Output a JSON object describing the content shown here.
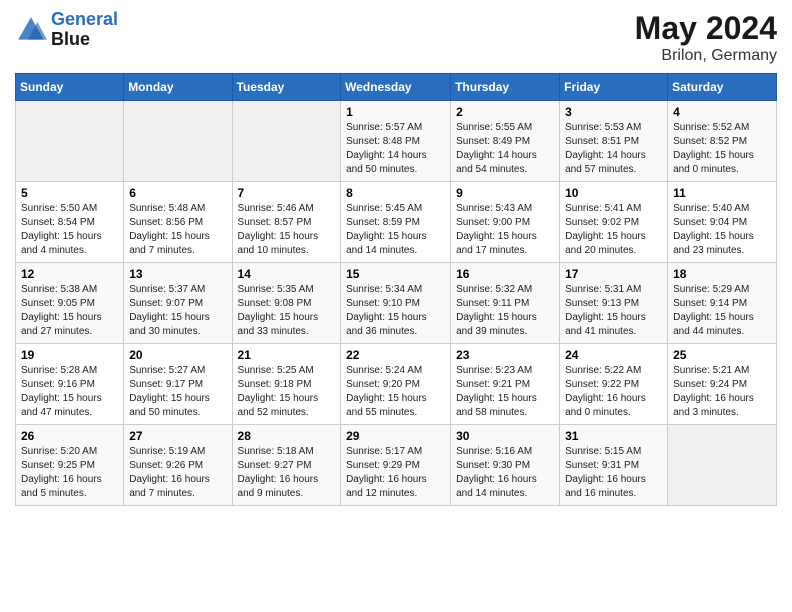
{
  "header": {
    "logo_line1": "General",
    "logo_line2": "Blue",
    "month": "May 2024",
    "location": "Brilon, Germany"
  },
  "days_of_week": [
    "Sunday",
    "Monday",
    "Tuesday",
    "Wednesday",
    "Thursday",
    "Friday",
    "Saturday"
  ],
  "weeks": [
    [
      {
        "day": "",
        "info": ""
      },
      {
        "day": "",
        "info": ""
      },
      {
        "day": "",
        "info": ""
      },
      {
        "day": "1",
        "info": "Sunrise: 5:57 AM\nSunset: 8:48 PM\nDaylight: 14 hours\nand 50 minutes."
      },
      {
        "day": "2",
        "info": "Sunrise: 5:55 AM\nSunset: 8:49 PM\nDaylight: 14 hours\nand 54 minutes."
      },
      {
        "day": "3",
        "info": "Sunrise: 5:53 AM\nSunset: 8:51 PM\nDaylight: 14 hours\nand 57 minutes."
      },
      {
        "day": "4",
        "info": "Sunrise: 5:52 AM\nSunset: 8:52 PM\nDaylight: 15 hours\nand 0 minutes."
      }
    ],
    [
      {
        "day": "5",
        "info": "Sunrise: 5:50 AM\nSunset: 8:54 PM\nDaylight: 15 hours\nand 4 minutes."
      },
      {
        "day": "6",
        "info": "Sunrise: 5:48 AM\nSunset: 8:56 PM\nDaylight: 15 hours\nand 7 minutes."
      },
      {
        "day": "7",
        "info": "Sunrise: 5:46 AM\nSunset: 8:57 PM\nDaylight: 15 hours\nand 10 minutes."
      },
      {
        "day": "8",
        "info": "Sunrise: 5:45 AM\nSunset: 8:59 PM\nDaylight: 15 hours\nand 14 minutes."
      },
      {
        "day": "9",
        "info": "Sunrise: 5:43 AM\nSunset: 9:00 PM\nDaylight: 15 hours\nand 17 minutes."
      },
      {
        "day": "10",
        "info": "Sunrise: 5:41 AM\nSunset: 9:02 PM\nDaylight: 15 hours\nand 20 minutes."
      },
      {
        "day": "11",
        "info": "Sunrise: 5:40 AM\nSunset: 9:04 PM\nDaylight: 15 hours\nand 23 minutes."
      }
    ],
    [
      {
        "day": "12",
        "info": "Sunrise: 5:38 AM\nSunset: 9:05 PM\nDaylight: 15 hours\nand 27 minutes."
      },
      {
        "day": "13",
        "info": "Sunrise: 5:37 AM\nSunset: 9:07 PM\nDaylight: 15 hours\nand 30 minutes."
      },
      {
        "day": "14",
        "info": "Sunrise: 5:35 AM\nSunset: 9:08 PM\nDaylight: 15 hours\nand 33 minutes."
      },
      {
        "day": "15",
        "info": "Sunrise: 5:34 AM\nSunset: 9:10 PM\nDaylight: 15 hours\nand 36 minutes."
      },
      {
        "day": "16",
        "info": "Sunrise: 5:32 AM\nSunset: 9:11 PM\nDaylight: 15 hours\nand 39 minutes."
      },
      {
        "day": "17",
        "info": "Sunrise: 5:31 AM\nSunset: 9:13 PM\nDaylight: 15 hours\nand 41 minutes."
      },
      {
        "day": "18",
        "info": "Sunrise: 5:29 AM\nSunset: 9:14 PM\nDaylight: 15 hours\nand 44 minutes."
      }
    ],
    [
      {
        "day": "19",
        "info": "Sunrise: 5:28 AM\nSunset: 9:16 PM\nDaylight: 15 hours\nand 47 minutes."
      },
      {
        "day": "20",
        "info": "Sunrise: 5:27 AM\nSunset: 9:17 PM\nDaylight: 15 hours\nand 50 minutes."
      },
      {
        "day": "21",
        "info": "Sunrise: 5:25 AM\nSunset: 9:18 PM\nDaylight: 15 hours\nand 52 minutes."
      },
      {
        "day": "22",
        "info": "Sunrise: 5:24 AM\nSunset: 9:20 PM\nDaylight: 15 hours\nand 55 minutes."
      },
      {
        "day": "23",
        "info": "Sunrise: 5:23 AM\nSunset: 9:21 PM\nDaylight: 15 hours\nand 58 minutes."
      },
      {
        "day": "24",
        "info": "Sunrise: 5:22 AM\nSunset: 9:22 PM\nDaylight: 16 hours\nand 0 minutes."
      },
      {
        "day": "25",
        "info": "Sunrise: 5:21 AM\nSunset: 9:24 PM\nDaylight: 16 hours\nand 3 minutes."
      }
    ],
    [
      {
        "day": "26",
        "info": "Sunrise: 5:20 AM\nSunset: 9:25 PM\nDaylight: 16 hours\nand 5 minutes."
      },
      {
        "day": "27",
        "info": "Sunrise: 5:19 AM\nSunset: 9:26 PM\nDaylight: 16 hours\nand 7 minutes."
      },
      {
        "day": "28",
        "info": "Sunrise: 5:18 AM\nSunset: 9:27 PM\nDaylight: 16 hours\nand 9 minutes."
      },
      {
        "day": "29",
        "info": "Sunrise: 5:17 AM\nSunset: 9:29 PM\nDaylight: 16 hours\nand 12 minutes."
      },
      {
        "day": "30",
        "info": "Sunrise: 5:16 AM\nSunset: 9:30 PM\nDaylight: 16 hours\nand 14 minutes."
      },
      {
        "day": "31",
        "info": "Sunrise: 5:15 AM\nSunset: 9:31 PM\nDaylight: 16 hours\nand 16 minutes."
      },
      {
        "day": "",
        "info": ""
      }
    ]
  ]
}
